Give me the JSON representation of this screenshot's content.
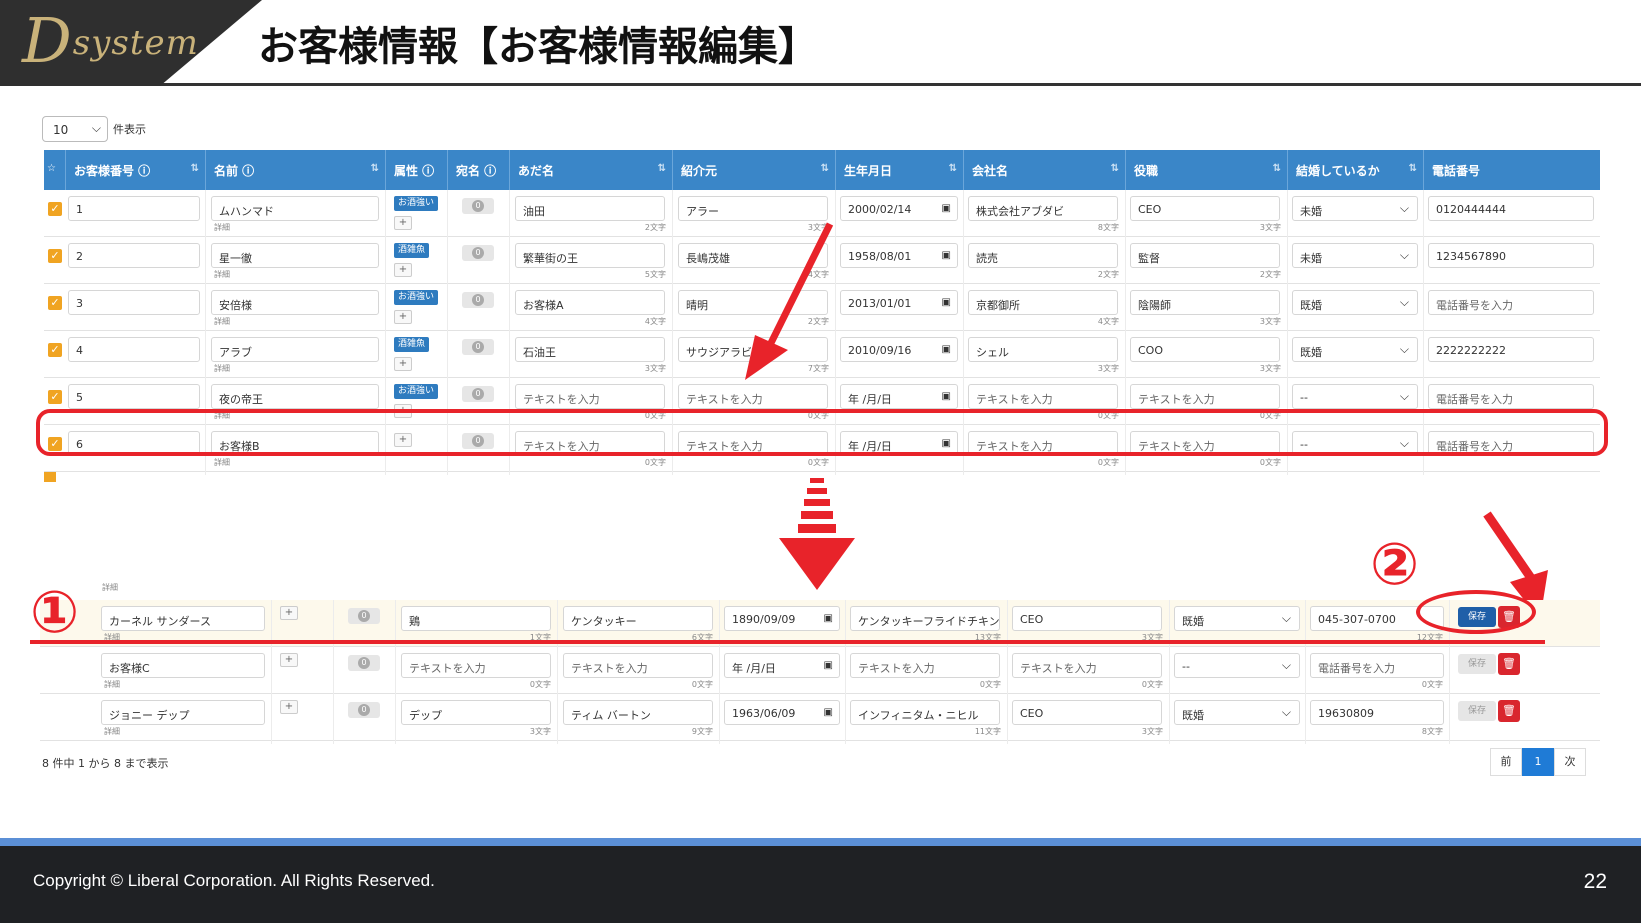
{
  "slide": {
    "logo": "Dsystem",
    "title": "お客様情報【お客様情報編集】",
    "footer_copyright": "Copyright ©  Liberal Corporation. All Rights Reserved.",
    "page_number": "22"
  },
  "controls": {
    "page_length": "10",
    "page_length_label": "件表示",
    "info": "8 件中 1 から 8 まで表示",
    "prev": "前",
    "current_page": "1",
    "next": "次"
  },
  "columns": [
    "お客様番号 ⓘ",
    "名前 ⓘ",
    "属性 ⓘ",
    "宛名 ⓘ",
    "あだ名",
    "紹介元",
    "生年月日",
    "会社名",
    "役職",
    "結婚しているか",
    "電話番号"
  ],
  "top_rows": [
    {
      "no": "1",
      "name": "ムハンマド",
      "detail": "詳細",
      "badge": "お酒強い",
      "nick": "油田",
      "nick_cnt": "2文字",
      "ref": "アラー",
      "ref_cnt": "3文字",
      "dob": "2000/02/14",
      "company": "株式会社アブダビ",
      "company_cnt": "8文字",
      "role": "CEO",
      "role_cnt": "3文字",
      "married": "未婚",
      "phone": "0120444444"
    },
    {
      "no": "2",
      "name": "星一徹",
      "detail": "詳細",
      "badge": "酒雑魚",
      "nick": "繁華街の王",
      "nick_cnt": "5文字",
      "ref": "長嶋茂雄",
      "ref_cnt": "4文字",
      "dob": "1958/08/01",
      "company": "読売",
      "company_cnt": "2文字",
      "role": "監督",
      "role_cnt": "2文字",
      "married": "未婚",
      "phone": "1234567890"
    },
    {
      "no": "3",
      "name": "安倍様",
      "detail": "詳細",
      "badge": "お酒強い",
      "nick": "お客様A",
      "nick_cnt": "4文字",
      "ref": "晴明",
      "ref_cnt": "2文字",
      "dob": "2013/01/01",
      "company": "京都御所",
      "company_cnt": "4文字",
      "role": "陰陽師",
      "role_cnt": "3文字",
      "married": "既婚",
      "phone": "電話番号を入力"
    },
    {
      "no": "4",
      "name": "アラブ",
      "detail": "詳細",
      "badge": "酒雑魚",
      "nick": "石油王",
      "nick_cnt": "3文字",
      "ref": "サウジアラビア",
      "ref_cnt": "7文字",
      "dob": "2010/09/16",
      "company": "シェル",
      "company_cnt": "3文字",
      "role": "COO",
      "role_cnt": "3文字",
      "married": "既婚",
      "phone": "2222222222"
    },
    {
      "no": "5",
      "name": "夜の帝王",
      "detail": "詳細",
      "badge": "お酒強い",
      "nick": "テキストを入力",
      "nick_cnt": "0文字",
      "ref": "テキストを入力",
      "ref_cnt": "0文字",
      "dob": "年 /月/日",
      "company": "テキストを入力",
      "company_cnt": "0文字",
      "role": "テキストを入力",
      "role_cnt": "0文字",
      "married": "--",
      "phone": "電話番号を入力"
    },
    {
      "no": "6",
      "name": "お客様B",
      "detail": "詳細",
      "badge": "",
      "nick": "テキストを入力",
      "nick_cnt": "0文字",
      "ref": "テキストを入力",
      "ref_cnt": "0文字",
      "dob": "年 /月/日",
      "company": "テキストを入力",
      "company_cnt": "0文字",
      "role": "テキストを入力",
      "role_cnt": "0文字",
      "married": "--",
      "phone": "電話番号を入力"
    }
  ],
  "bottom_rows": [
    {
      "name": "カーネル サンダース",
      "detail": "詳細",
      "nick": "鶏",
      "nick_cnt": "1文字",
      "ref": "ケンタッキー",
      "ref_cnt": "6文字",
      "dob": "1890/09/09",
      "company": "ケンタッキーフライドチキン",
      "company_cnt": "13文字",
      "role": "CEO",
      "role_cnt": "3文字",
      "married": "既婚",
      "phone": "045-307-0700",
      "phone_cnt": "12文字",
      "save": "保存"
    },
    {
      "name": "お客様C",
      "detail": "詳細",
      "nick": "テキストを入力",
      "nick_cnt": "0文字",
      "ref": "テキストを入力",
      "ref_cnt": "0文字",
      "dob": "年 /月/日",
      "company": "テキストを入力",
      "company_cnt": "0文字",
      "role": "テキストを入力",
      "role_cnt": "0文字",
      "married": "--",
      "phone": "電話番号を入力",
      "phone_cnt": "0文字",
      "save": "保存"
    },
    {
      "name": "ジョニー デップ",
      "detail": "詳細",
      "nick": "デップ",
      "nick_cnt": "3文字",
      "ref": "ティム バートン",
      "ref_cnt": "9文字",
      "dob": "1963/06/09",
      "company": "インフィニタム・ニヒル",
      "company_cnt": "11文字",
      "role": "CEO",
      "role_cnt": "3文字",
      "married": "既婚",
      "phone": "19630809",
      "phone_cnt": "8文字",
      "save": "保存"
    }
  ],
  "annotations": {
    "one": "①",
    "two": "②"
  },
  "colors": {
    "header_blue": "#3a86c8",
    "annotation_red": "#e8232a",
    "checkbox_orange": "#f0a422",
    "save_blue": "#1f5fa8"
  }
}
